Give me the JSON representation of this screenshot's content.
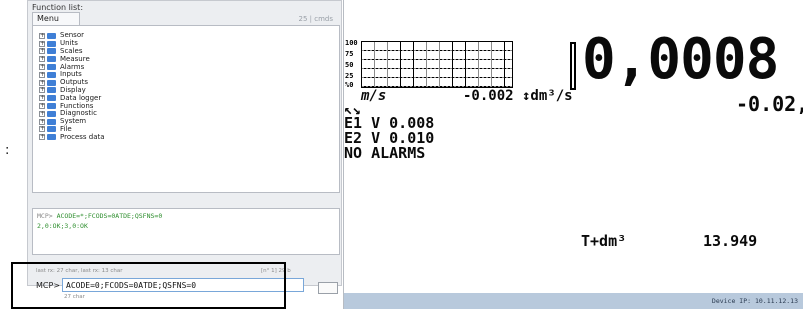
{
  "left": {
    "title": "Function list:",
    "tab": "Menu",
    "cmds": "25 | cmds",
    "tree": [
      "Sensor",
      "Units",
      "Scales",
      "Measure",
      "Alarms",
      "Inputs",
      "Outputs",
      "Display",
      "Data logger",
      "Functions",
      "Diagnostic",
      "System",
      "File",
      "Process data"
    ],
    "log_prompt": "MCP>",
    "log_cmd": "ACODE=*;FCODS=0ATDE;QSFNS=0",
    "log_reply": "2,0:OK;3,0:OK",
    "last_info": "last rx: 27 char, last rx: 13 char",
    "pos_info": "[n° 1] 29 b",
    "mcp_label": "MCP>",
    "input_value": "ACODE=0;FCODS=0ATDE;QSFNS=0",
    "char_count": "27 char",
    "outside_colon": ":"
  },
  "device": {
    "y_labels": [
      "100",
      "75",
      "50",
      "25",
      "%0"
    ],
    "big_value": "0,0008",
    "unit1": "m/s",
    "value2": "-0.002",
    "unit2": "↕dm³/s",
    "value3": "-0.02,",
    "arrows": "↖↘",
    "row_e1": "E1  V      0.008",
    "row_e2": "E2  V      0.010",
    "alarms": "NO ALARMS",
    "totalizer_label": "T+dm³",
    "totalizer_value": "13.949",
    "device_ip": "Device IP: 10.11.12.13"
  },
  "colors": {
    "accent": "#2f78c9",
    "footer": "#b8c9dc",
    "log_text": "#2f8f2f"
  },
  "icons": [
    "plus-icon",
    "folder-icon",
    "keyboard-icon",
    "send-icon"
  ]
}
